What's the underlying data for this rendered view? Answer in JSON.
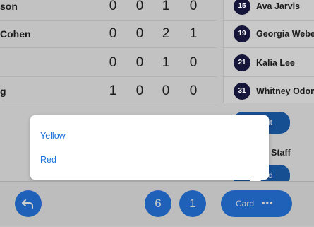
{
  "scores": {
    "rows": [
      {
        "name": "son",
        "stats": [
          "0",
          "0",
          "1",
          "0"
        ]
      },
      {
        "name": "Cohen",
        "stats": [
          "0",
          "0",
          "2",
          "1"
        ]
      },
      {
        "name": "",
        "stats": [
          "0",
          "0",
          "1",
          "0"
        ]
      },
      {
        "name": "g",
        "stats": [
          "1",
          "0",
          "0",
          "0"
        ]
      }
    ]
  },
  "players": [
    {
      "number": "15",
      "name": "Ava Jarvis"
    },
    {
      "number": "19",
      "name": "Georgia Weber"
    },
    {
      "number": "21",
      "name": "Kalia Lee"
    },
    {
      "number": "31",
      "name": "Whitney Odom"
    }
  ],
  "background": {
    "edit_fragment": "it",
    "staff_fragment": "Staff",
    "add_fragment": "d"
  },
  "popup": {
    "options": [
      "Yellow",
      "Red"
    ]
  },
  "footer": {
    "back_icon": "undo-arrow-icon",
    "counter_1": "6",
    "counter_2": "1",
    "card_label": "Card",
    "more_icon": "ellipsis-icon",
    "more_glyph": "•••"
  },
  "colors": {
    "primary_button": "#1f61b8",
    "number_badge": "#15163a",
    "option_text": "#1a73d9"
  }
}
